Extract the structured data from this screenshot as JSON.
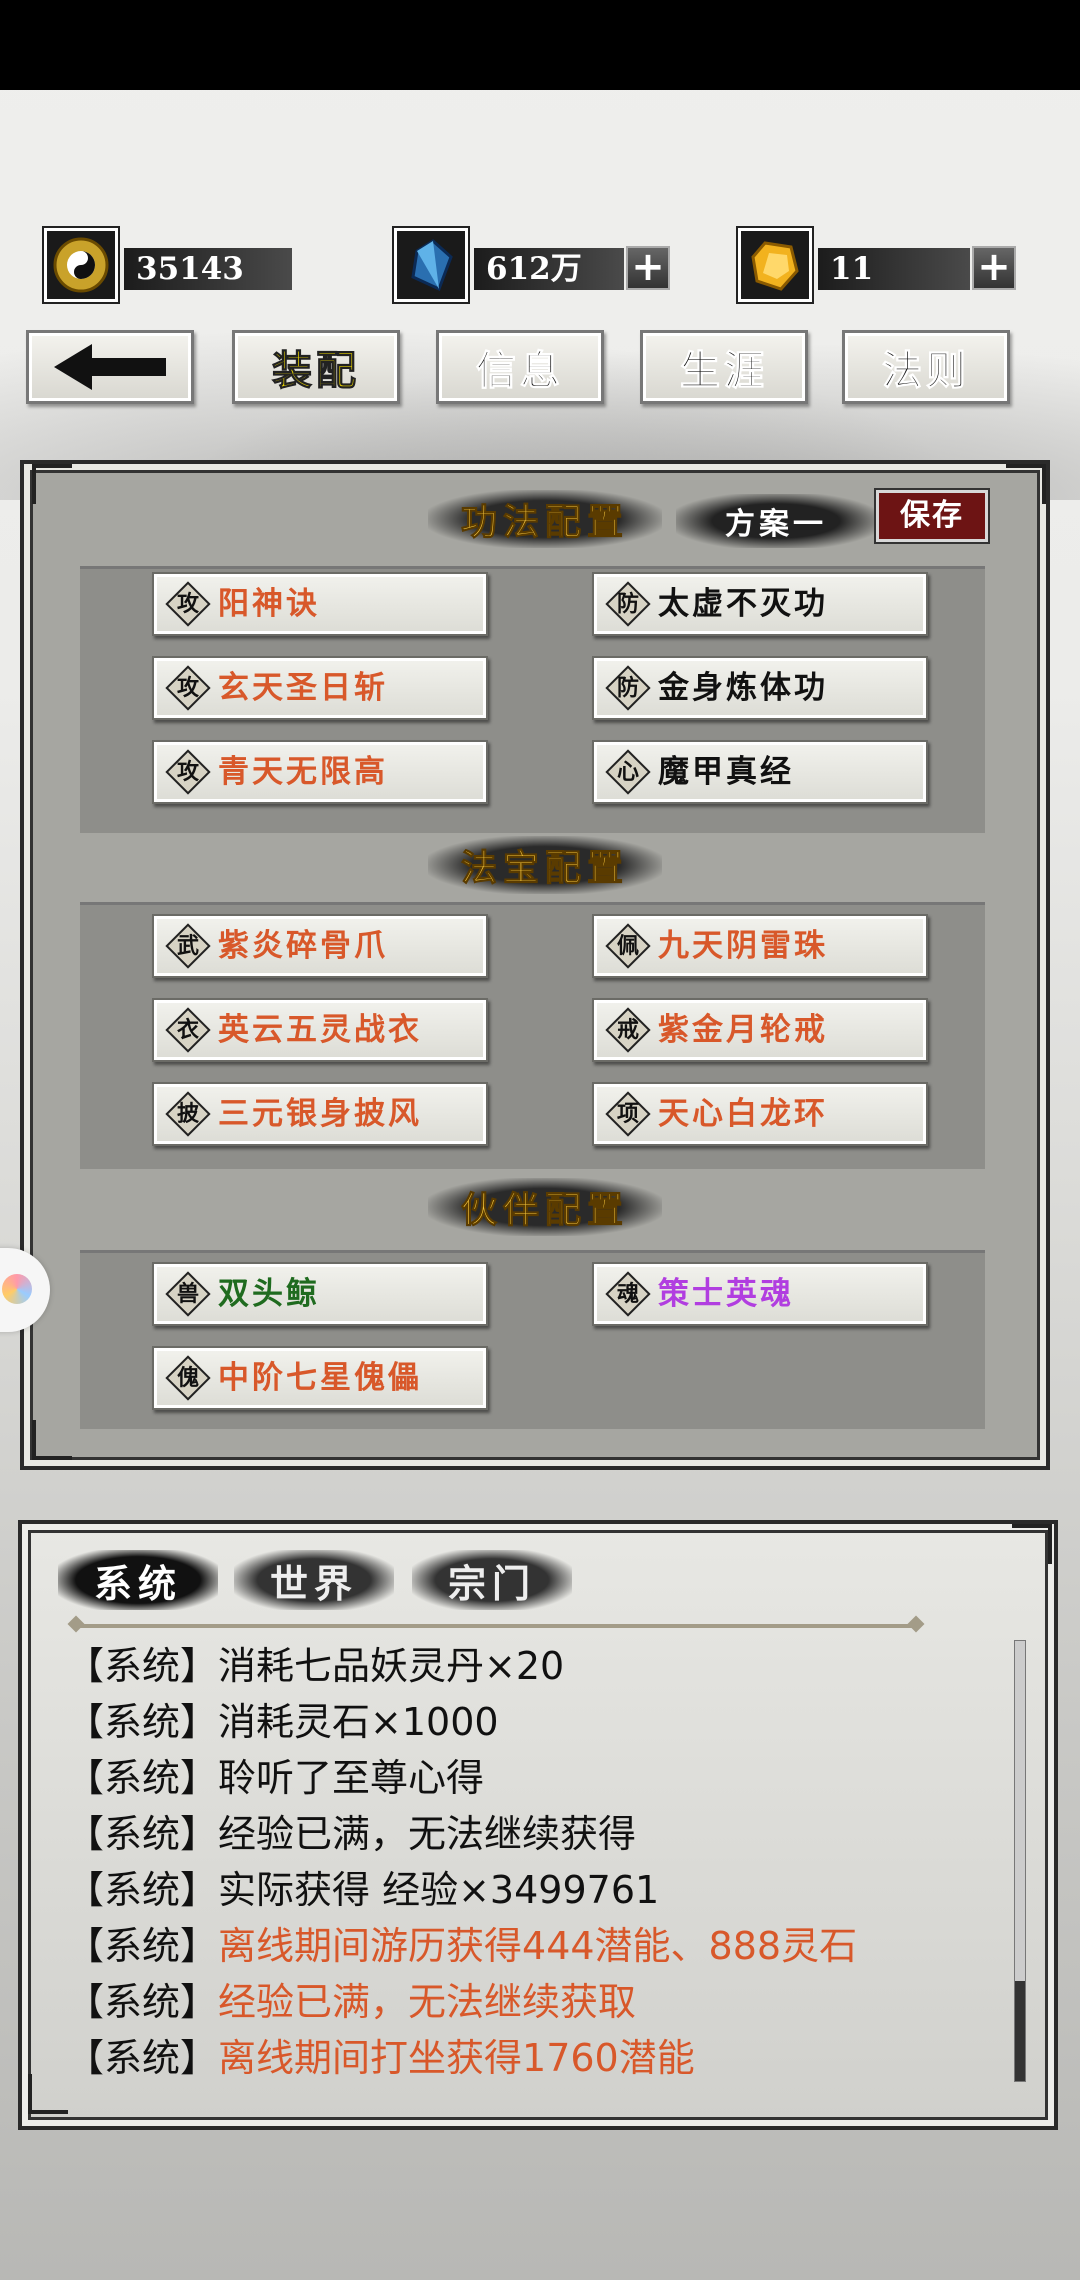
{
  "currency": {
    "taiji_value": "35143",
    "crystal_value": "612万",
    "gem_value": "11"
  },
  "nav": {
    "back": "←",
    "equip": "装配",
    "info": "信息",
    "career": "生涯",
    "rules": "法则"
  },
  "skills": {
    "title": "功法配置",
    "plan": "方案一",
    "save": "保存",
    "items": [
      {
        "badge": "攻",
        "name": "阳神诀",
        "color": "#d8582a"
      },
      {
        "badge": "防",
        "name": "太虚不灭功",
        "color": "#111111"
      },
      {
        "badge": "攻",
        "name": "玄天圣日斩",
        "color": "#d8582a"
      },
      {
        "badge": "防",
        "name": "金身炼体功",
        "color": "#111111"
      },
      {
        "badge": "攻",
        "name": "青天无限高",
        "color": "#d8582a"
      },
      {
        "badge": "心",
        "name": "魔甲真经",
        "color": "#111111"
      }
    ]
  },
  "treasures": {
    "title": "法宝配置",
    "items": [
      {
        "badge": "武",
        "name": "紫炎碎骨爪",
        "color": "#d8582a"
      },
      {
        "badge": "佩",
        "name": "九天阴雷珠",
        "color": "#d8582a"
      },
      {
        "badge": "衣",
        "name": "英云五灵战衣",
        "color": "#d8582a"
      },
      {
        "badge": "戒",
        "name": "紫金月轮戒",
        "color": "#d8582a"
      },
      {
        "badge": "披",
        "name": "三元银身披风",
        "color": "#d8582a"
      },
      {
        "badge": "项",
        "name": "天心白龙环",
        "color": "#d8582a"
      }
    ]
  },
  "partners": {
    "title": "伙伴配置",
    "items": [
      {
        "badge": "兽",
        "name": "双头鲸",
        "color": "#1f6b1f"
      },
      {
        "badge": "魂",
        "name": "策士英魂",
        "color": "#b13ee0"
      },
      {
        "badge": "傀",
        "name": "中阶七星傀儡",
        "color": "#d8582a"
      }
    ]
  },
  "chat": {
    "tabs": [
      "系统",
      "世界",
      "宗门"
    ],
    "messages": [
      {
        "prefix": "【系统】",
        "text": "消耗七品妖灵丹×20",
        "orange": false
      },
      {
        "prefix": "【系统】",
        "text": "消耗灵石×1000",
        "orange": false
      },
      {
        "prefix": "【系统】",
        "text": "聆听了至尊心得",
        "orange": false
      },
      {
        "prefix": "【系统】",
        "text": "经验已满，无法继续获得",
        "orange": false
      },
      {
        "prefix": "【系统】",
        "text": "实际获得 经验×3499761",
        "orange": false
      },
      {
        "prefix": "【系统】",
        "text": "离线期间游历获得444潜能、888灵石",
        "orange": true
      },
      {
        "prefix": "【系统】",
        "text": "经验已满，无法继续获取",
        "orange": true
      },
      {
        "prefix": "【系统】",
        "text": "离线期间打坐获得1760潜能",
        "orange": true
      }
    ]
  }
}
